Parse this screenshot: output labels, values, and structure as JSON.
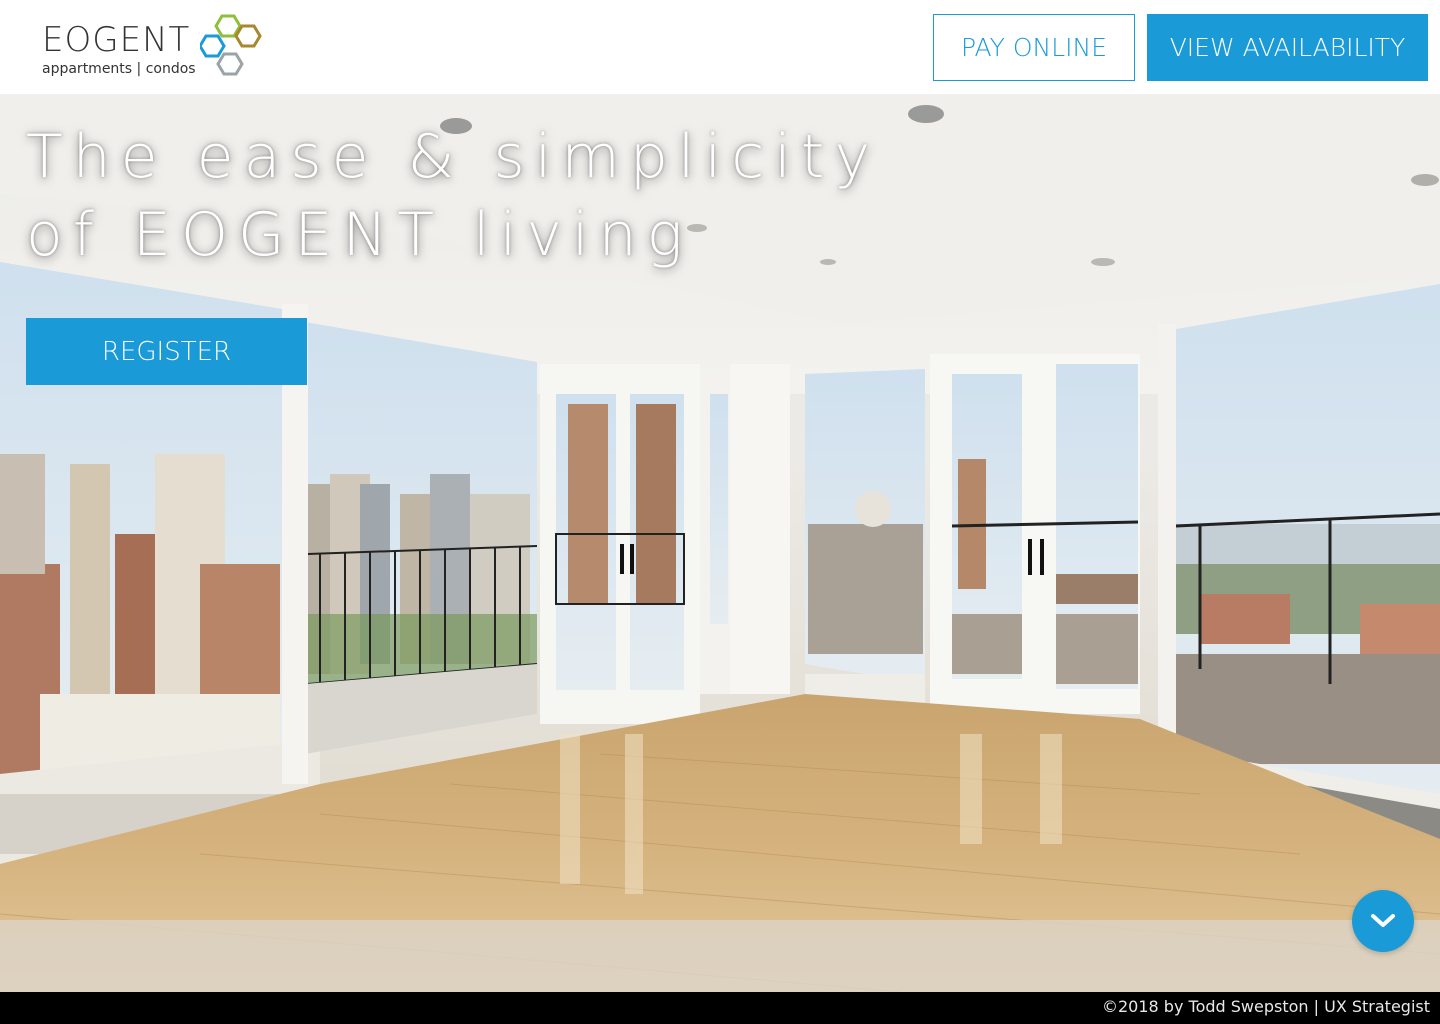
{
  "header": {
    "logo_word": "EOGENT",
    "logo_tagline": "appartments | condos",
    "pay_online_label": "PAY ONLINE",
    "view_availability_label": "VIEW AVAILABILITY"
  },
  "hero": {
    "headline_line1": "The ease & simplicity",
    "headline_line2": "of EOGENT living",
    "register_label": "REGISTER",
    "scroll_icon": "chevron-down-icon",
    "photo": "apartment-interior-city-view"
  },
  "footer": {
    "credit": "©2018 by Todd Swepston | UX Strategist"
  },
  "colors": {
    "accent": "#1a9ad6",
    "logo_hex_green": "#8fbf3a",
    "logo_hex_gold": "#a8872e",
    "logo_hex_blue": "#1a9ad6",
    "logo_hex_gray": "#9aa3a8"
  }
}
